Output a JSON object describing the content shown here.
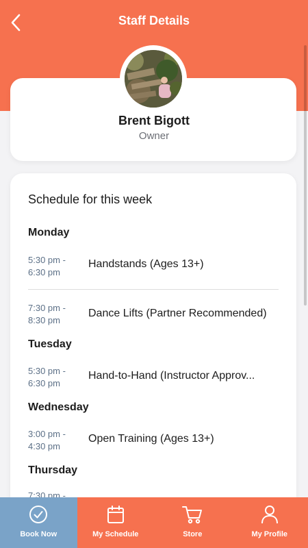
{
  "header": {
    "title": "Staff Details",
    "back_icon": "chevron-left-icon"
  },
  "staff": {
    "name": "Brent Bigott",
    "role": "Owner",
    "avatar": "staff-photo"
  },
  "schedule": {
    "title": "Schedule for this week",
    "days": [
      {
        "day": "Monday",
        "classes": [
          {
            "time": "5:30 pm -\n6:30 pm",
            "name": "Handstands (Ages 13+)"
          },
          {
            "time": "7:30 pm -\n8:30 pm",
            "name": "Dance Lifts (Partner Recommended)"
          }
        ]
      },
      {
        "day": "Tuesday",
        "classes": [
          {
            "time": "5:30 pm -\n6:30 pm",
            "name": "Hand-to-Hand (Instructor Approv..."
          }
        ]
      },
      {
        "day": "Wednesday",
        "classes": [
          {
            "time": "3:00 pm -\n4:30 pm",
            "name": "Open Training (Ages 13+)"
          }
        ]
      },
      {
        "day": "Thursday",
        "classes": [
          {
            "time": "7:30 pm -",
            "name": ""
          }
        ]
      }
    ]
  },
  "nav": {
    "items": [
      {
        "label": "Book Now",
        "icon": "check-circle-icon",
        "active": true
      },
      {
        "label": "My Schedule",
        "icon": "calendar-icon",
        "active": false
      },
      {
        "label": "Store",
        "icon": "cart-icon",
        "active": false
      },
      {
        "label": "My Profile",
        "icon": "person-icon",
        "active": false
      }
    ]
  },
  "colors": {
    "brand": "#f6714f",
    "active_tab": "#7aa3c8",
    "time_text": "#5b6f86"
  }
}
